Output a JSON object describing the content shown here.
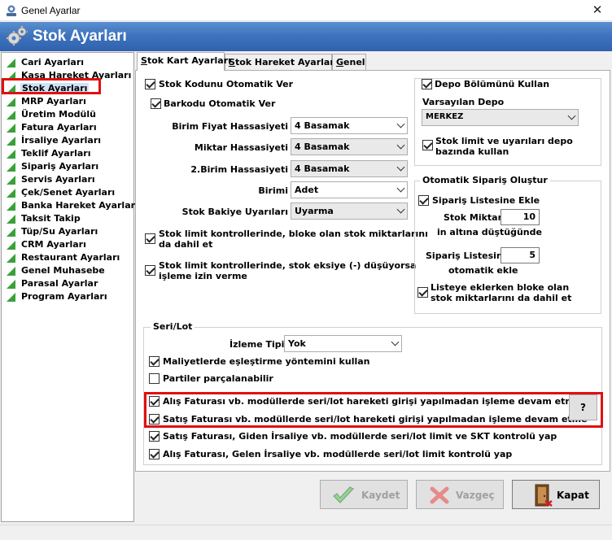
{
  "window": {
    "title": "Genel Ayarlar",
    "close_glyph": "✕"
  },
  "banner": {
    "title": "Stok Ayarları"
  },
  "tree": {
    "items": [
      {
        "label": "Cari Ayarları"
      },
      {
        "label": "Kasa Hareket Ayarları"
      },
      {
        "label": "Stok Ayarları"
      },
      {
        "label": "MRP Ayarları"
      },
      {
        "label": "Üretim Modülü"
      },
      {
        "label": "Fatura Ayarları"
      },
      {
        "label": "İrsaliye Ayarları"
      },
      {
        "label": "Teklif Ayarları"
      },
      {
        "label": "Sipariş Ayarları"
      },
      {
        "label": "Servis Ayarları"
      },
      {
        "label": "Çek/Senet Ayarları"
      },
      {
        "label": "Banka Hareket Ayarları"
      },
      {
        "label": "Taksit Takip"
      },
      {
        "label": "Tüp/Su Ayarları"
      },
      {
        "label": "CRM Ayarları"
      },
      {
        "label": "Restaurant Ayarları"
      },
      {
        "label": "Genel Muhasebe"
      },
      {
        "label": "Parasal Ayarlar"
      },
      {
        "label": "Program Ayarları"
      }
    ]
  },
  "tabs": [
    {
      "first": "S",
      "rest": "tok Kart Ayarları"
    },
    {
      "first": "S",
      "rest": "tok Hareket Ayarları"
    },
    {
      "first": "G",
      "rest": "enel"
    }
  ],
  "left": {
    "stok_kodu_oto": "Stok Kodunu Otomatik Ver",
    "barkod_oto": "Barkodu Otomatik Ver",
    "birim_fiyat_label": "Birim Fiyat Hassasiyeti",
    "birim_fiyat_value": "4 Basamak",
    "miktar_label": "Miktar Hassasiyeti",
    "miktar_value": "4 Basamak",
    "birim2_label": "2.Birim Hassasiyeti",
    "birim2_value": "4 Basamak",
    "birimi_label": "Birimi",
    "birimi_value": "Adet",
    "bakiye_label": "Stok Bakiye Uyarıları",
    "bakiye_value": "Uyarma",
    "bloke_line1": "Stok limit kontrollerinde, bloke olan stok miktarlarını",
    "bloke_line2": "da dahil et",
    "eksi_line1": "Stok limit kontrollerinde, stok eksiye (-) düşüyorsa",
    "eksi_line2": "işleme izin verme"
  },
  "depo": {
    "depo_kullan": "Depo Bölümünü Kullan",
    "varsayilan_label": "Varsayılan Depo",
    "varsayilan_value": "MERKEZ",
    "limit_line1": "Stok limit ve uyarıları depo",
    "limit_line2": "bazında kullan"
  },
  "oto_siparis": {
    "title": "Otomatik Sipariş Oluştur",
    "listeye_ekle": "Sipariş Listesine Ekle",
    "stok_miktari": "Stok Miktarı",
    "stok_miktari_value": "10",
    "altina": "in altına düştüğünde",
    "siparis_listesine": "Sipariş Listesine",
    "siparis_value": "5",
    "otomatik_ekle": "otomatik ekle",
    "bloke_line1": "Listeye eklerken bloke olan",
    "bloke_line2": "stok miktarlarını da dahil et"
  },
  "seri": {
    "title": "Seri/Lot",
    "izleme_label": "İzleme Tipi",
    "izleme_value": "Yok",
    "maliyet": "Maliyetlerde eşleştirme yöntemini kullan",
    "partiler": "Partiler parçalanabilir",
    "alis": "Alış Faturası vb. modüllerde seri/lot hareketi girişi yapılmadan işleme devam etme",
    "satis": "Satış Faturası vb. modüllerde seri/lot hareketi girişi yapılmadan işleme devam etme",
    "satis_limit": "Satış Faturası, Giden İrsaliye vb. modüllerde seri/lot limit ve SKT kontrolü yap",
    "alis_limit": "Alış Faturası, Gelen İrsaliye vb. modüllerde seri/lot limit kontrolü yap",
    "help": "?"
  },
  "buttons": {
    "kaydet": "Kaydet",
    "vazgec": "Vazgeç",
    "kapat": "Kapat"
  },
  "colors": {
    "banner": "#3f74bd",
    "highlight": "#e01010",
    "tree_icon": "#3aa13a"
  }
}
